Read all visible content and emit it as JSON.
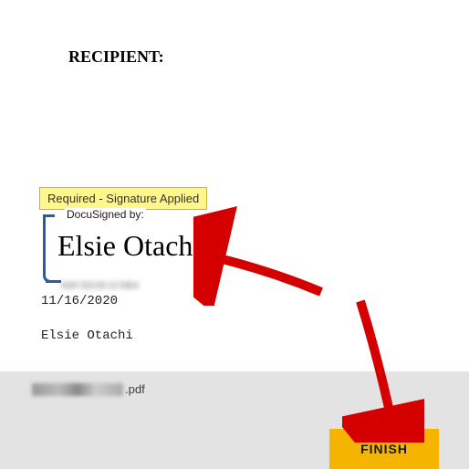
{
  "document": {
    "recipient_label": "RECIPIENT:",
    "status_badge": "Required - Signature Applied",
    "docusigned_label": "DocuSigned by:",
    "signature_name": "Elsie Otachi",
    "signature_id": "A8F3D2E1C9B4",
    "date": "11/16/2020",
    "signer_printed": "Elsie Otachi"
  },
  "footer": {
    "file_extension": ".pdf",
    "finish_label": "FINISH"
  }
}
